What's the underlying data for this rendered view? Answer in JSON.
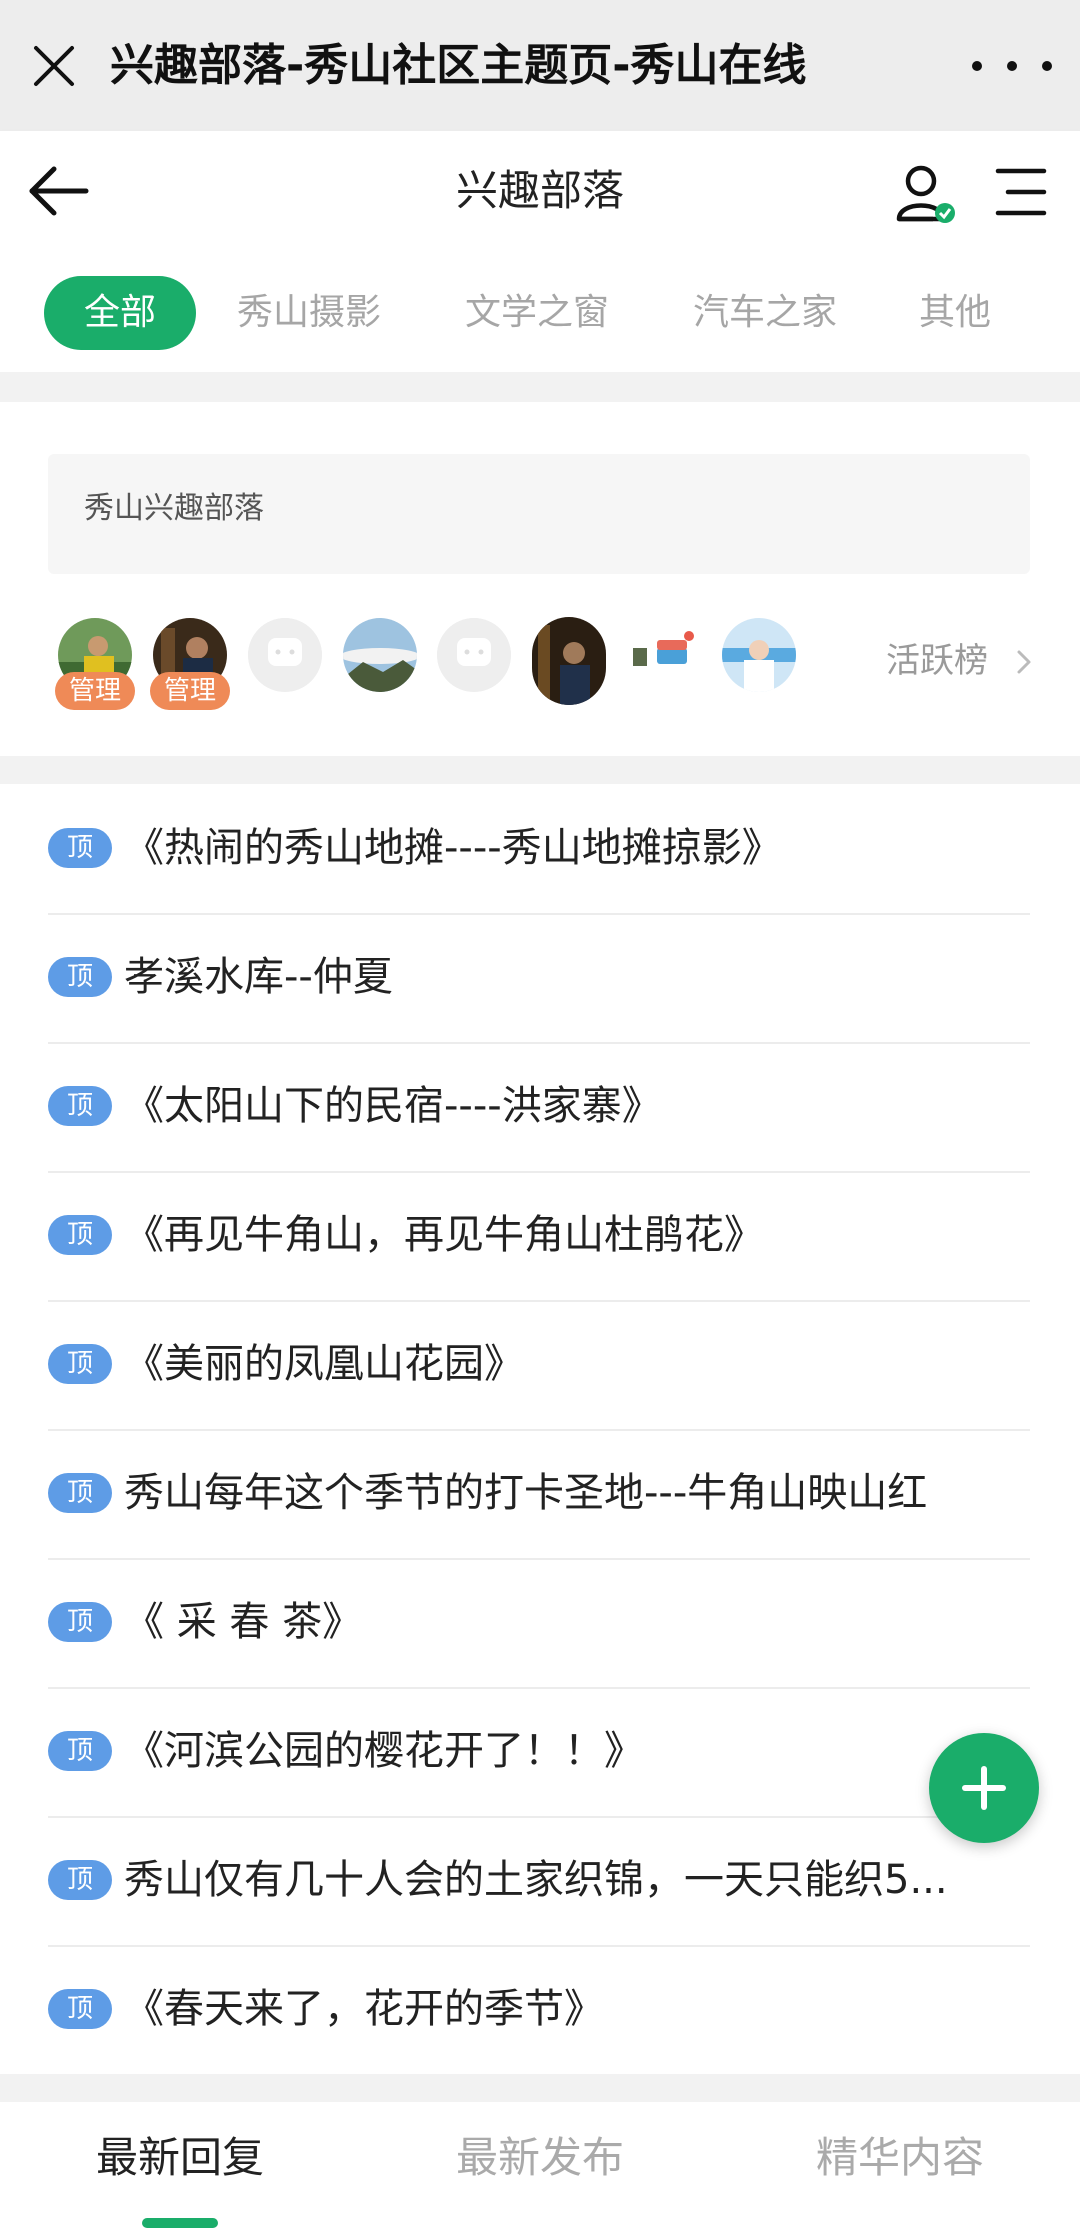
{
  "wechat_bar": {
    "title": "兴趣部落-秀山社区主题页-秀山在线",
    "close_icon": "close-icon",
    "more_icon": "more-icon"
  },
  "header": {
    "title": "兴趣部落",
    "back_icon": "back-arrow-icon",
    "user_icon": "user-icon",
    "menu_icon": "menu-icon"
  },
  "tabs": [
    {
      "label": "全部",
      "active": true
    },
    {
      "label": "秀山摄影",
      "active": false
    },
    {
      "label": "文学之窗",
      "active": false
    },
    {
      "label": "汽车之家",
      "active": false
    },
    {
      "label": "其他",
      "active": false
    }
  ],
  "intro": {
    "text": "秀山兴趣部落"
  },
  "members": {
    "admin_badge": "管理",
    "ranking_label": "活跃榜",
    "ranking_icon": "chevron-right-icon"
  },
  "pin_label": "顶",
  "posts": [
    "《热闹的秀山地摊----秀山地摊掠影》",
    "孝溪水库--仲夏",
    "《太阳山下的民宿----洪家寨》",
    "《再见牛角山，再见牛角山杜鹃花》",
    "《美丽的凤凰山花园》",
    "秀山每年这个季节的打卡圣地---牛角山映山红",
    "《 采 春 茶》",
    "《河滨公园的樱花开了！！》",
    "秀山仅有几十人会的土家织锦，一天只能织5...",
    "《春天来了，花开的季节》"
  ],
  "fab_icon": "plus-icon",
  "bottom_tabs": [
    {
      "label": "最新回复",
      "active": true
    },
    {
      "label": "最新发布",
      "active": false
    },
    {
      "label": "精华内容",
      "active": false
    }
  ],
  "colors": {
    "accent": "#1aad6a",
    "admin_badge": "#ef8a57",
    "pin_badge": "#5e9ce6"
  }
}
